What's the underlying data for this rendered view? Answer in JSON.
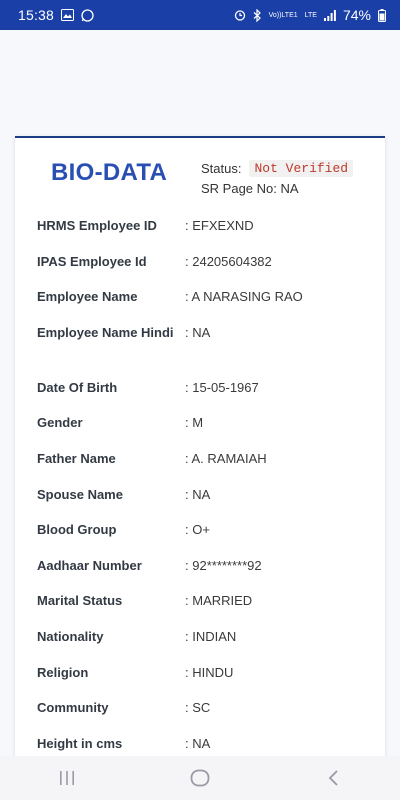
{
  "status_bar": {
    "time": "15:38",
    "battery_pct": "74%",
    "network_label_top": "Vo))",
    "network_label_bottom": "LTE1",
    "lte_label": "LTE"
  },
  "card": {
    "title": "BIO-DATA",
    "status_label": "Status:",
    "status_value": "Not Verified",
    "sr_page": "SR Page No: NA"
  },
  "fields": [
    {
      "label": "HRMS Employee ID",
      "value": "EFXEXND"
    },
    {
      "label": "IPAS Employee Id",
      "value": "24205604382"
    },
    {
      "label": "Employee Name",
      "value": "A NARASING RAO"
    },
    {
      "label": "Employee Name Hindi",
      "value": "NA"
    },
    {
      "label": "Date Of Birth",
      "value": "15-05-1967"
    },
    {
      "label": "Gender",
      "value": "M"
    },
    {
      "label": "Father Name",
      "value": "A. RAMAIAH"
    },
    {
      "label": "Spouse Name",
      "value": "NA"
    },
    {
      "label": "Blood Group",
      "value": "O+"
    },
    {
      "label": "Aadhaar Number",
      "value": "92********92"
    },
    {
      "label": "Marital Status",
      "value": "MARRIED"
    },
    {
      "label": "Nationality",
      "value": "INDIAN"
    },
    {
      "label": "Religion",
      "value": "HINDU"
    },
    {
      "label": "Community",
      "value": "SC"
    },
    {
      "label": "Height in cms",
      "value": "NA"
    }
  ],
  "colors": {
    "status_bar": "#1a3fa6",
    "title": "#2a4fb3",
    "status_badge": "#c0392b"
  }
}
